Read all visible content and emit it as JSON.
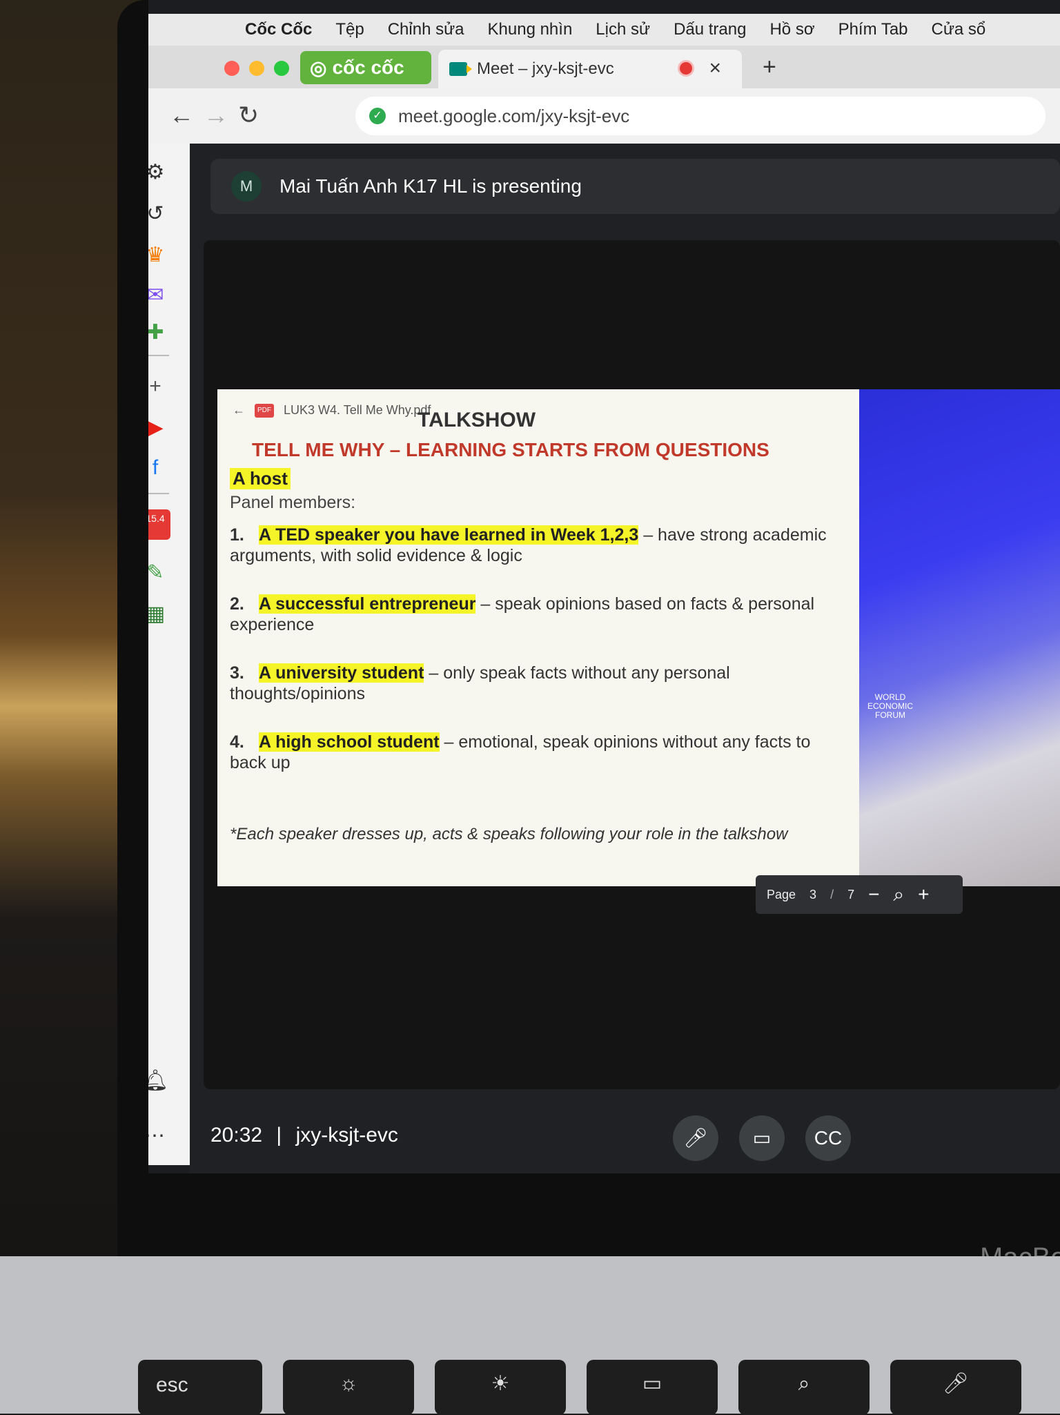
{
  "menubar": {
    "app_name": "Cốc Cốc",
    "items": [
      "Tệp",
      "Chỉnh sửa",
      "Khung nhìn",
      "Lịch sử",
      "Dấu trang",
      "Hồ sơ",
      "Phím Tab",
      "Cửa sổ"
    ]
  },
  "browser": {
    "brand_label": "cốc cốc",
    "tab_title": "Meet – jxy-ksjt-evc",
    "url": "meet.google.com/jxy-ksjt-evc"
  },
  "sidebar": {
    "badge_shop": "15.4"
  },
  "meet": {
    "avatar_letter": "M",
    "presenting_text": "Mai Tuấn Anh K17 HL is presenting",
    "time": "20:32",
    "separator": "|",
    "meeting_code": "jxy-ksjt-evc"
  },
  "slide": {
    "pdf_name": "LUK3 W4. Tell Me Why.pdf",
    "heading": "TALKSHOW",
    "title": "TELL ME WHY – LEARNING STARTS FROM QUESTIONS",
    "host": "A host",
    "panel_label": "Panel members:",
    "items": [
      {
        "num": "1.",
        "role": "A TED speaker you have learned in Week 1,2,3",
        "desc": " – have strong academic arguments, with solid evidence & logic"
      },
      {
        "num": "2.",
        "role": "A successful entrepreneur",
        "desc": " – speak opinions based on facts & personal experience"
      },
      {
        "num": "3.",
        "role": "A university student",
        "desc": " – only speak facts without any personal thoughts/opinions"
      },
      {
        "num": "4.",
        "role": "A high school student",
        "desc": " – emotional, speak opinions without any facts to back up"
      }
    ],
    "note": "*Each speaker dresses up, acts & speaks following your role in the talkshow",
    "photo_label": "WORLD ECONOMIC FORUM"
  },
  "pager": {
    "label": "Page",
    "current": "3",
    "slash": "/",
    "total": "7"
  },
  "keyboard": {
    "esc": "esc",
    "brand": "MacBo"
  },
  "colors": {
    "accent_green": "#62b33d",
    "highlight": "#f4f429",
    "slide_title": "#c0392b"
  }
}
